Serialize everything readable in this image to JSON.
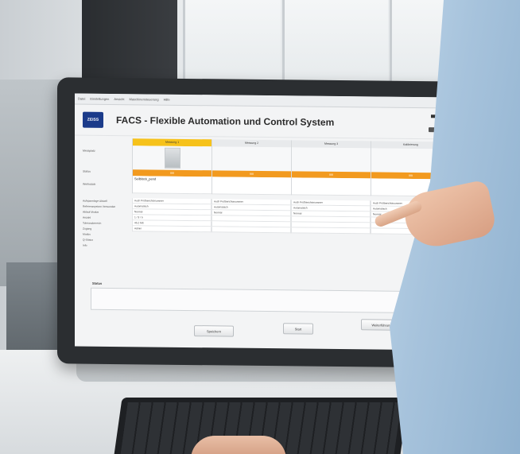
{
  "screen": {
    "menu": [
      "Datei",
      "Einstellungen",
      "Ansicht",
      "Maschinensteuerung",
      "Hilfe"
    ],
    "app_title": "FACS - Flexible Automation und Control System",
    "logo_text": "ZEISS",
    "columns": [
      {
        "header": "Messung 1",
        "active": true,
        "orange": "IIIII",
        "white": "Seilblock_pend"
      },
      {
        "header": "Messung 2",
        "active": false,
        "orange": "IIIII",
        "white": ""
      },
      {
        "header": "Messung 3",
        "active": false,
        "orange": "IIIII",
        "white": ""
      },
      {
        "header": "Kalibrierung",
        "active": false,
        "orange": "IIIII",
        "white": ""
      }
    ],
    "row_labels": {
      "top": "Messplatz",
      "orange": "Status",
      "white": "Werkstück"
    },
    "params": [
      {
        "label": "Aufspannlage Aktuell",
        "cells": [
          "Auch Prüfberichtsnummer",
          "Auch Prüfberichtsnummer",
          "Auch Prüfberichtsnummer",
          "Auch Prüfberichtsnummer"
        ]
      },
      {
        "label": "Referenzsystem Verwenden",
        "cells": [
          "Automatisch",
          "Automatisch",
          "Automatisch",
          "Automatisch"
        ]
      },
      {
        "label": "Ablauf Modus",
        "cells": [
          "Normal",
          "Normal",
          "Normal",
          "Normal"
        ]
      },
      {
        "label": "Anzahl",
        "cells": [
          "1 / 3 / 5",
          "",
          "",
          ""
        ]
      },
      {
        "label": "Toleranzbereich",
        "cells": [
          "45.2 Mß",
          "",
          "",
          ""
        ]
      },
      {
        "label": "Zugang",
        "cells": [
          "Admin",
          "",
          "",
          ""
        ]
      },
      {
        "label": "Modus",
        "cells": [
          "",
          "",
          "",
          ""
        ]
      },
      {
        "label": "Q-Status",
        "cells": [
          "",
          "",
          "",
          ""
        ]
      },
      {
        "label": "Info",
        "cells": [
          "",
          "",
          "",
          ""
        ]
      }
    ],
    "status_label": "Status",
    "buttons": {
      "save": "Speichern",
      "start": "Start",
      "stop": "Weiterführung Starten"
    }
  },
  "colors": {
    "accent_yellow": "#f6c21b",
    "status_orange": "#f29a1f",
    "logo_blue": "#1b3b8a"
  }
}
